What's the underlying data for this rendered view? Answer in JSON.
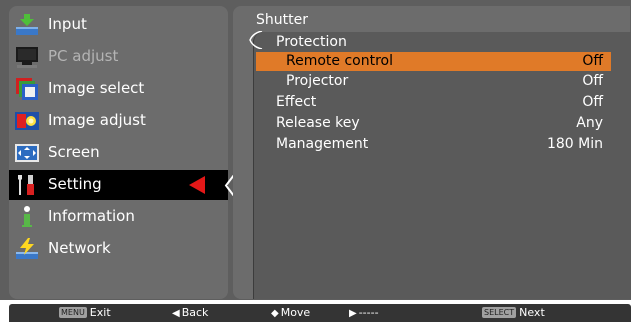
{
  "left_menu": {
    "items": [
      {
        "label": "Input",
        "icon": "input-icon"
      },
      {
        "label": "PC adjust",
        "icon": "pc-adjust-icon"
      },
      {
        "label": "Image select",
        "icon": "image-select-icon"
      },
      {
        "label": "Image adjust",
        "icon": "image-adjust-icon"
      },
      {
        "label": "Screen",
        "icon": "screen-icon"
      },
      {
        "label": "Setting",
        "icon": "setting-icon"
      },
      {
        "label": "Information",
        "icon": "information-icon"
      },
      {
        "label": "Network",
        "icon": "network-icon"
      }
    ],
    "selected_index": 5
  },
  "panel": {
    "title": "Shutter",
    "rows": [
      {
        "label": "Protection",
        "value": ""
      },
      {
        "label": "Remote control",
        "value": "Off"
      },
      {
        "label": "Projector",
        "value": "Off"
      },
      {
        "label": "Effect",
        "value": "Off"
      },
      {
        "label": "Release key",
        "value": "Any"
      },
      {
        "label": "Management",
        "value": "180 Min"
      }
    ],
    "highlighted_index": 1
  },
  "bottom_bar": {
    "exit_key": "MENU",
    "exit_label": "Exit",
    "back_label": "Back",
    "move_label": "Move",
    "right_label": "-----",
    "next_key": "SELECT",
    "next_label": "Next"
  },
  "colors": {
    "highlight": "#e07a28",
    "selected_arrow": "#e41818",
    "panel_bg": "#6c6c6c"
  }
}
